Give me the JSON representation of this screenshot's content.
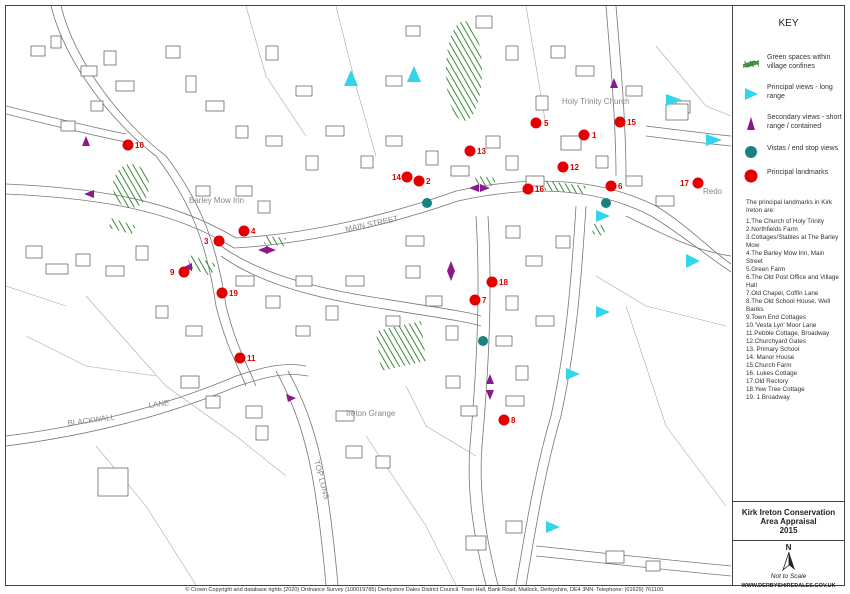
{
  "map": {
    "labels": {
      "barley_mow": "Barley Mow Inn",
      "main_street": "MAIN STREET",
      "blackwall_lane": "BLACKWALL",
      "blackwall_lane2": "LANE",
      "top_lons": "TOP LONS",
      "ireton_grange": "Ireton Grange",
      "church": "Holy Trinity Church",
      "redo": "Redo"
    },
    "landmarks": [
      {
        "id": "1",
        "label": "1"
      },
      {
        "id": "2",
        "label": "2"
      },
      {
        "id": "3",
        "label": "3"
      },
      {
        "id": "4",
        "label": "4"
      },
      {
        "id": "5",
        "label": "5"
      },
      {
        "id": "6",
        "label": "6"
      },
      {
        "id": "7",
        "label": "7"
      },
      {
        "id": "8",
        "label": "8"
      },
      {
        "id": "9",
        "label": "9"
      },
      {
        "id": "10",
        "label": "10"
      },
      {
        "id": "11",
        "label": "11"
      },
      {
        "id": "12",
        "label": "12"
      },
      {
        "id": "13",
        "label": "13"
      },
      {
        "id": "14",
        "label": "14"
      },
      {
        "id": "15",
        "label": "15"
      },
      {
        "id": "16",
        "label": "16"
      },
      {
        "id": "17",
        "label": "17"
      },
      {
        "id": "18",
        "label": "18"
      },
      {
        "id": "19",
        "label": "19"
      }
    ],
    "colors": {
      "landmark": "#e40000",
      "long_view": "#33d6e8",
      "short_view": "#8a1a8a",
      "vista": "#1a8080",
      "green": "#3a8a3a"
    }
  },
  "legend": {
    "title": "KEY",
    "items": [
      {
        "label": "Green spaces within village confines",
        "icon": "hatch-icon"
      },
      {
        "label": "Principal views - long range",
        "icon": "cyan-triangle-icon"
      },
      {
        "label": "Secondary views - short range / contained",
        "icon": "purple-triangle-icon"
      },
      {
        "label": "Vistas / end stop views",
        "icon": "teal-circle-icon"
      },
      {
        "label": "Principal landmarks",
        "icon": "red-circle-icon"
      }
    ],
    "landmarks_intro": "The principal landmarks in Kirk Ireton are:",
    "landmarks_list": [
      "1.The Church of Holy Trinity",
      "2.Northfields Farm",
      "3.Cottages/Stables at The Barley Mow",
      "4.The Barley Mow Inn, Main Street",
      "5.Green Farm",
      "6.The Old Post Office and Village Hall",
      "7.Old Chapel, Coffin Lane",
      "8.The Old School House, Well Banks",
      "9.Town End Cottages",
      "10.'Vesta Lyn' Moor Lane",
      "11.Pebble Cottage, Broadway",
      "12.Churchyard Gates",
      "13. Primary School",
      "14. Manor House",
      "15.Church Farm",
      "16. Lukes Cottage",
      "17.Old Rectory",
      "18.Yew Tree Cottage",
      "19. 1 Broadway"
    ],
    "title_box": {
      "line1": "Kirk Ireton Conservation",
      "line2": "Area Appraisal",
      "line3": "2015"
    },
    "north": "N",
    "scale_note": "Not to Scale",
    "website": "WWW.DERBYSHIREDALES.GOV.UK"
  },
  "footer": "© Crown Copyright and database rights (2020) Ordnance Survey (100019785) Derbyshire Dales District Council. Town Hall, Bank Road, Matlock, Derbyshire, DE4 3NN. Telephone: (01629) 761100."
}
